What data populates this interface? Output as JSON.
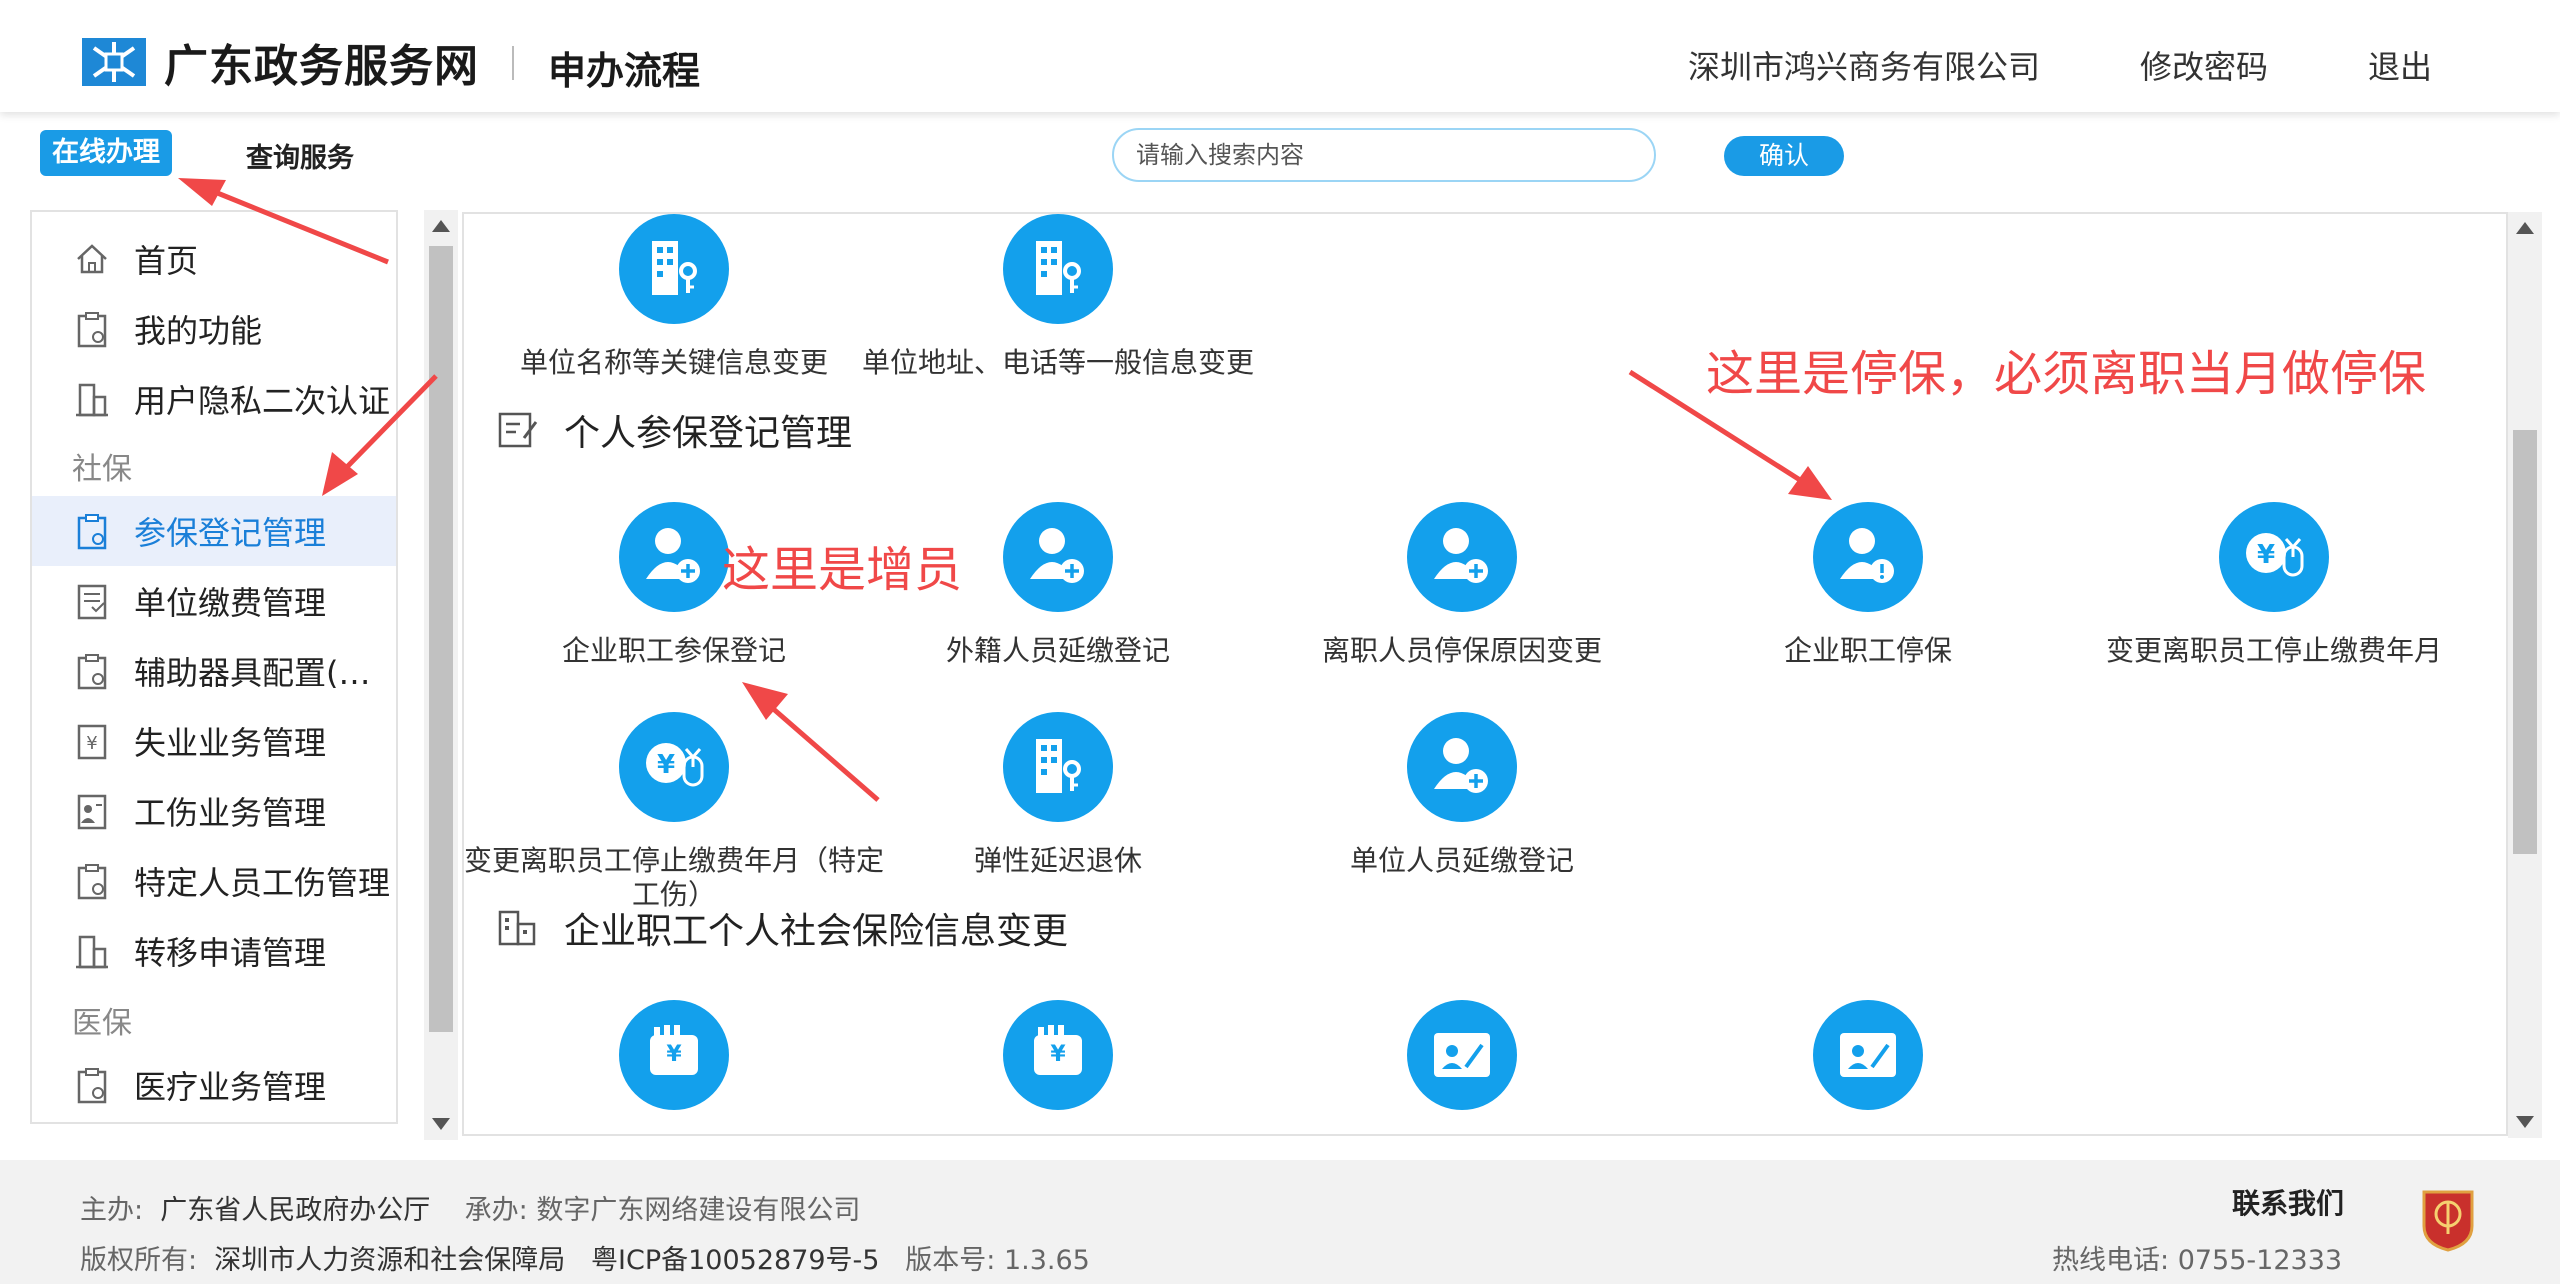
{
  "header": {
    "brand": "广东政务服务网",
    "subtitle": "申办流程",
    "company": "深圳市鸿兴商务有限公司",
    "change_password": "修改密码",
    "logout": "退出"
  },
  "tabs": {
    "online": "在线办理",
    "query": "查询服务"
  },
  "search": {
    "placeholder": "请输入搜索内容",
    "confirm": "确认"
  },
  "sidebar": {
    "items": [
      {
        "label": "首页",
        "icon": "home-icon"
      },
      {
        "label": "我的功能",
        "icon": "clipboard-icon"
      },
      {
        "label": "用户隐私二次认证",
        "icon": "building-icon"
      }
    ],
    "group_social": "社保",
    "social_items": [
      {
        "label": "参保登记管理",
        "icon": "clipboard-gear-icon",
        "active": true
      },
      {
        "label": "单位缴费管理",
        "icon": "invoice-icon"
      },
      {
        "label": "辅助器具配置(更...",
        "icon": "clipboard-gear-icon"
      },
      {
        "label": "失业业务管理",
        "icon": "yuan-doc-icon"
      },
      {
        "label": "工伤业务管理",
        "icon": "person-doc-icon"
      },
      {
        "label": "特定人员工伤管理",
        "icon": "clipboard-gear-icon"
      },
      {
        "label": "转移申请管理",
        "icon": "building-icon"
      }
    ],
    "group_medical": "医保",
    "medical_items": [
      {
        "label": "医疗业务管理",
        "icon": "clipboard-gear-icon"
      }
    ]
  },
  "content": {
    "top_services": [
      {
        "label": "单位名称等关键信息变更",
        "icon": "building-key-icon"
      },
      {
        "label": "单位地址、电话等一般信息变更",
        "icon": "building-key-icon"
      }
    ],
    "section_personal": "个人参保登记管理",
    "personal_services": [
      {
        "label": "企业职工参保登记",
        "icon": "person-add-icon"
      },
      {
        "label": "外籍人员延缴登记",
        "icon": "person-add-icon"
      },
      {
        "label": "离职人员停保原因变更",
        "icon": "person-add-icon"
      },
      {
        "label": "企业职工停保",
        "icon": "person-alert-icon"
      },
      {
        "label": "变更离职员工停止缴费年月",
        "icon": "yuan-mouse-icon"
      },
      {
        "label": "变更离职员工停止缴费年月（特定工伤）",
        "icon": "yuan-mouse-icon"
      },
      {
        "label": "弹性延迟退休",
        "icon": "building-key-icon"
      },
      {
        "label": "单位人员延缴登记",
        "icon": "person-add-icon"
      }
    ],
    "section_change": "企业职工个人社会保险信息变更",
    "change_services": [
      {
        "icon": "yuan-hand-icon"
      },
      {
        "icon": "yuan-hand-icon"
      },
      {
        "icon": "id-card-edit-icon"
      },
      {
        "icon": "id-card-edit-icon"
      }
    ]
  },
  "annotations": {
    "stop": "这里是停保，必须离职当月做停保",
    "add": "这里是增员"
  },
  "footer": {
    "host_label": "主办:",
    "host": "广东省人民政府办公厅",
    "operator_label": "承办:",
    "operator": "数字广东网络建设有限公司",
    "copyright_label": "版权所有:",
    "copyright": "深圳市人力资源和社会保障局",
    "icp": "粤ICP备10052879号-5",
    "version_label": "版本号:",
    "version": "1.3.65",
    "contact": "联系我们",
    "hotline_label": "热线电话:",
    "hotline": "0755-12333"
  },
  "colors": {
    "accent": "#13a0ec",
    "annotation": "#f04848"
  }
}
